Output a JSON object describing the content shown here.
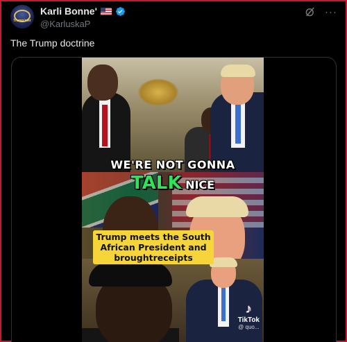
{
  "post": {
    "display_name": "Karli Bonne'",
    "handle": "@KarluskaP",
    "text": "The Trump doctrine",
    "avatar_text": "Trump'ster"
  },
  "icons": {
    "flag": "us-flag-icon",
    "verified": "verified-badge-icon",
    "grok": "grok-icon",
    "more": "more-options-icon",
    "tiktok": "tiktok-logo-icon"
  },
  "more_glyph": "···",
  "video": {
    "caption_line1": "WE'RE NOT GONNA",
    "caption_talk": "TALK",
    "caption_nice": "NICE",
    "subtitle": "Trump meets the South African President and broughtreceipts",
    "watermark_name": "TikTok",
    "watermark_handle": "@ quo..."
  },
  "colors": {
    "border": "#c81b2a",
    "verified": "#1d9bf0",
    "talk": "#2fe35a",
    "subtitle_bg": "#f6d53a"
  }
}
